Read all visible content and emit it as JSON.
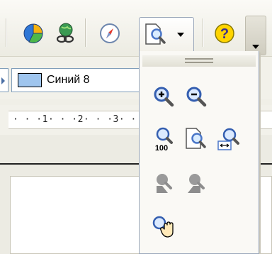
{
  "toolbar": {
    "buttons": [
      {
        "name": "chart-button",
        "icon": "pie-chart-icon"
      },
      {
        "name": "hyperlink-button",
        "icon": "globe-link-icon"
      },
      {
        "name": "navigator-button",
        "icon": "compass-icon"
      },
      {
        "name": "zoom-button",
        "icon": "zoom-icon"
      },
      {
        "name": "help-button",
        "icon": "help-icon"
      }
    ],
    "overflow": {
      "icon": "chevron-down-icon"
    }
  },
  "formatting": {
    "line_color": {
      "label": "Синий 8",
      "swatch_color": "#9fc5ee"
    }
  },
  "ruler": {
    "text": "· · ·1· · ·2· · ·3· ·"
  },
  "zoom_flyout": {
    "items": [
      {
        "name": "zoom-in-button",
        "icon": "zoom-in-icon",
        "enabled": true
      },
      {
        "name": "zoom-out-button",
        "icon": "zoom-out-icon",
        "enabled": true
      },
      {
        "name": "zoom-100-button",
        "icon": "zoom-100-icon",
        "enabled": true,
        "caption": "100"
      },
      {
        "name": "zoom-page-button",
        "icon": "zoom-whole-page-icon",
        "enabled": true
      },
      {
        "name": "zoom-page-width-button",
        "icon": "zoom-page-width-icon",
        "enabled": true
      },
      {
        "name": "zoom-previous-button",
        "icon": "zoom-previous-icon",
        "enabled": false
      },
      {
        "name": "zoom-next-button",
        "icon": "zoom-next-icon",
        "enabled": false
      },
      {
        "name": "pan-button",
        "icon": "pan-hand-icon",
        "enabled": true
      }
    ]
  },
  "colors": {
    "accent_blue": "#4a76c8",
    "help_yellow": "#ffd400",
    "disabled_gray": "#8d8d8d"
  }
}
